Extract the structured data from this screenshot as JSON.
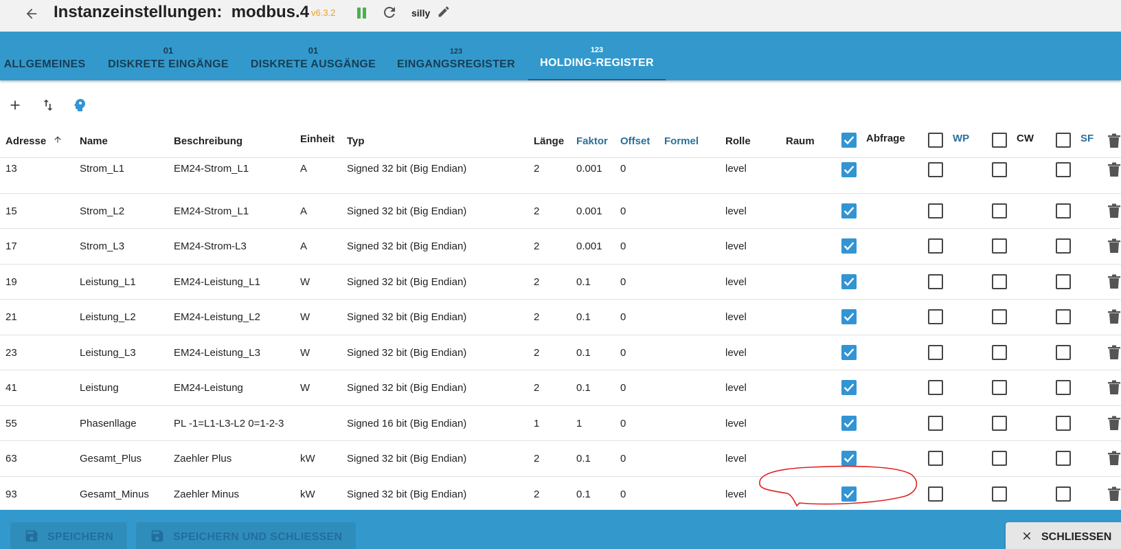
{
  "header": {
    "title": "Instanzeinstellungen:  modbus.4",
    "version": "v6.3.2",
    "loglevel": "silly",
    "colors": {
      "version": "#f0a020",
      "pause": "#4caf50"
    }
  },
  "tabs": [
    {
      "label": "ALLGEMEINES",
      "icon": ""
    },
    {
      "label": "DISKRETE EINGÄNGE",
      "icon": "01"
    },
    {
      "label": "DISKRETE AUSGÄNGE",
      "icon": "01"
    },
    {
      "label": "EINGANGSREGISTER",
      "icon": "123"
    },
    {
      "label": "HOLDING-REGISTER",
      "icon": "123"
    }
  ],
  "toolbar": {
    "add_icon": "plus-icon",
    "sort_icon": "swap-vertical-icon",
    "expert_icon": "head-icon"
  },
  "columns": {
    "address": "Adresse",
    "name": "Name",
    "description": "Beschreibung",
    "unit": "Einheit",
    "type": "Typ",
    "length": "Länge",
    "factor": "Faktor",
    "offset": "Offset",
    "formula": "Formel",
    "role": "Rolle",
    "room": "Raum",
    "poll": "Abfrage",
    "wp": "WP",
    "cw": "CW",
    "sf": "SF"
  },
  "header_checks": {
    "poll": true,
    "wp": false,
    "cw": false,
    "sf": false
  },
  "rows": [
    {
      "address": "13",
      "name": "Strom_L1",
      "description": "EM24-Strom_L1",
      "unit": "A",
      "type": "Signed 32 bit (Big Endian)",
      "length": "2",
      "factor": "0.001",
      "offset": "0",
      "formula": "",
      "role": "level",
      "room": "",
      "poll": true,
      "wp": false,
      "cw": false,
      "sf": false
    },
    {
      "address": "15",
      "name": "Strom_L2",
      "description": "EM24-Strom_L1",
      "unit": "A",
      "type": "Signed 32 bit (Big Endian)",
      "length": "2",
      "factor": "0.001",
      "offset": "0",
      "formula": "",
      "role": "level",
      "room": "",
      "poll": true,
      "wp": false,
      "cw": false,
      "sf": false
    },
    {
      "address": "17",
      "name": "Strom_L3",
      "description": "EM24-Strom-L3",
      "unit": "A",
      "type": "Signed 32 bit (Big Endian)",
      "length": "2",
      "factor": "0.001",
      "offset": "0",
      "formula": "",
      "role": "level",
      "room": "",
      "poll": true,
      "wp": false,
      "cw": false,
      "sf": false
    },
    {
      "address": "19",
      "name": "Leistung_L1",
      "description": "EM24-Leistung_L1",
      "unit": "W",
      "type": "Signed 32 bit (Big Endian)",
      "length": "2",
      "factor": "0.1",
      "offset": "0",
      "formula": "",
      "role": "level",
      "room": "",
      "poll": true,
      "wp": false,
      "cw": false,
      "sf": false
    },
    {
      "address": "21",
      "name": "Leistung_L2",
      "description": "EM24-Leistung_L2",
      "unit": "W",
      "type": "Signed 32 bit (Big Endian)",
      "length": "2",
      "factor": "0.1",
      "offset": "0",
      "formula": "",
      "role": "level",
      "room": "",
      "poll": true,
      "wp": false,
      "cw": false,
      "sf": false
    },
    {
      "address": "23",
      "name": "Leistung_L3",
      "description": "EM24-Leistung_L3",
      "unit": "W",
      "type": "Signed 32 bit (Big Endian)",
      "length": "2",
      "factor": "0.1",
      "offset": "0",
      "formula": "",
      "role": "level",
      "room": "",
      "poll": true,
      "wp": false,
      "cw": false,
      "sf": false
    },
    {
      "address": "41",
      "name": "Leistung",
      "description": "EM24-Leistung",
      "unit": "W",
      "type": "Signed 32 bit (Big Endian)",
      "length": "2",
      "factor": "0.1",
      "offset": "0",
      "formula": "",
      "role": "level",
      "room": "",
      "poll": true,
      "wp": false,
      "cw": false,
      "sf": false
    },
    {
      "address": "55",
      "name": "Phasenllage",
      "description": "PL -1=L1-L3-L2 0=1-2-3",
      "unit": "",
      "type": "Signed 16 bit (Big Endian)",
      "length": "1",
      "factor": "1",
      "offset": "0",
      "formula": "",
      "role": "level",
      "room": "",
      "poll": true,
      "wp": false,
      "cw": false,
      "sf": false
    },
    {
      "address": "63",
      "name": "Gesamt_Plus",
      "description": "Zaehler Plus",
      "unit": "kW",
      "type": "Signed 32 bit (Big Endian)",
      "length": "2",
      "factor": "0.1",
      "offset": "0",
      "formula": "",
      "role": "level",
      "room": "",
      "poll": true,
      "wp": false,
      "cw": false,
      "sf": false
    },
    {
      "address": "93",
      "name": "Gesamt_Minus",
      "description": "Zaehler Minus",
      "unit": "kW",
      "type": "Signed 32 bit (Big Endian)",
      "length": "2",
      "factor": "0.1",
      "offset": "0",
      "formula": "",
      "role": "level",
      "room": "",
      "poll": true,
      "wp": false,
      "cw": false,
      "sf": false
    }
  ],
  "footer": {
    "save_label": "SPEICHERN",
    "save_close_label": "SPEICHERN UND SCHLIESSEN",
    "close_label": "SCHLIESSEN"
  }
}
